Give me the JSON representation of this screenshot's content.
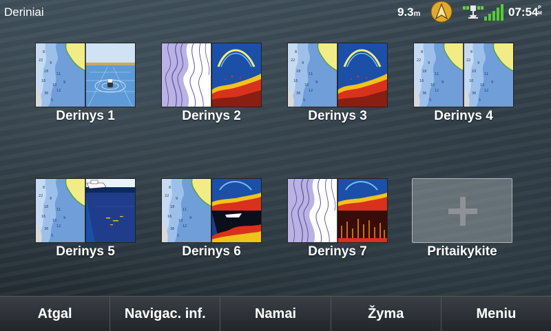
{
  "header": {
    "title": "Deriniai",
    "depth_value": "9.3",
    "depth_unit": "m",
    "time": "07:54",
    "ampm_top": "P",
    "ampm_bottom": "M",
    "icons": [
      "navigation-arrow-icon",
      "gps-satellite-icon",
      "signal-strength-icon"
    ]
  },
  "tiles": [
    {
      "label": "Derinys 1",
      "left": "chart",
      "right": "3d"
    },
    {
      "label": "Derinys 2",
      "left": "contour",
      "right": "sonar"
    },
    {
      "label": "Derinys 3",
      "left": "chart",
      "right": "sonar"
    },
    {
      "label": "Derinys 4",
      "left": "chart",
      "right": "chart"
    },
    {
      "label": "Derinys 5",
      "left": "chart",
      "right": "sidevu"
    },
    {
      "label": "Derinys 6",
      "left": "chart",
      "right": "sonar-split"
    },
    {
      "label": "Derinys 7",
      "left": "contour",
      "right": "sonar-livescope"
    },
    {
      "label": "Pritaikykite",
      "left": "plus-icon",
      "right": ""
    }
  ],
  "bottom_bar": {
    "back": "Atgal",
    "nav_info": "Navigac. inf.",
    "home": "Namai",
    "mode": "Žyma",
    "menu": "Meniu"
  },
  "colors": {
    "water_blue": "#6f9ed8",
    "shallow_blue": "#9dc0ea",
    "land_yellow": "#f2ec88",
    "sonar_blue": "#1c4fa8",
    "sonar_red": "#d8321c",
    "nav_gold": "#e2a92a"
  }
}
